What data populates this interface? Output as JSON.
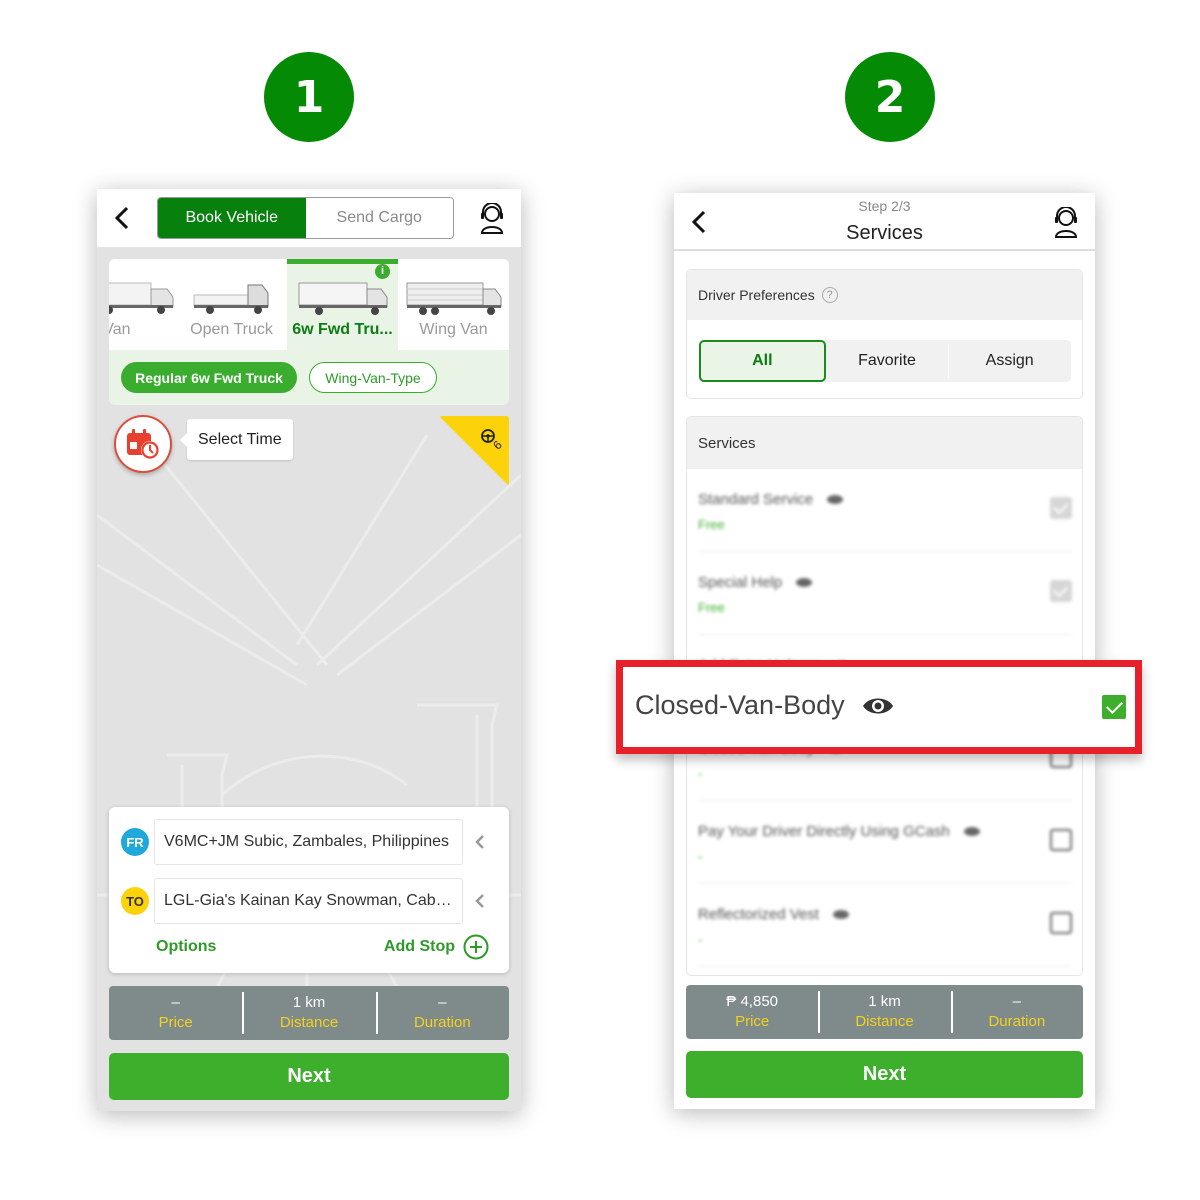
{
  "steps": [
    {
      "number": "1"
    },
    {
      "number": "2"
    }
  ],
  "screen1": {
    "tabs": [
      {
        "label": "Book Vehicle",
        "active": true
      },
      {
        "label": "Send Cargo",
        "active": false
      }
    ],
    "vehicles": [
      {
        "label": "Closed Van",
        "visible_label": "sed Van",
        "selected": false
      },
      {
        "label": "Open Truck",
        "selected": false
      },
      {
        "label": "6w Fwd Tru...",
        "selected": true
      },
      {
        "label": "Wing Van",
        "selected": false
      }
    ],
    "info_badge": "i",
    "subtypes": [
      {
        "label": "Regular 6w Fwd Truck",
        "selected": true
      },
      {
        "label": "Wing-Van-Type",
        "selected": false
      }
    ],
    "select_time_label": "Select Time",
    "corner_badge_count": "9",
    "route": {
      "from_badge": "FR",
      "from_address": "V6MC+JM Subic, Zambales, Philippines",
      "to_badge": "TO",
      "to_address": "LGL-Gia's Kainan Kay Snowman, Caban...",
      "options_label": "Options",
      "add_stop_label": "Add Stop"
    },
    "stats": [
      {
        "value": "–",
        "label": "Price"
      },
      {
        "value": "1 km",
        "label": "Distance"
      },
      {
        "value": "–",
        "label": "Duration"
      }
    ],
    "next_label": "Next"
  },
  "screen2": {
    "step_indicator": "Step 2/3",
    "title": "Services",
    "driver_preferences": {
      "heading": "Driver Preferences",
      "help_icon": "?",
      "options": [
        {
          "label": "All",
          "selected": true
        },
        {
          "label": "Favorite",
          "selected": false
        },
        {
          "label": "Assign",
          "selected": false
        }
      ]
    },
    "services": {
      "heading": "Services",
      "items": [
        {
          "name": "Standard Service",
          "price": "Free",
          "checked": true,
          "disabled": true
        },
        {
          "name": "Special Help",
          "price": "Free",
          "checked": true,
          "disabled": true
        },
        {
          "name": "Add Extra Helpers",
          "price": "-",
          "checked": false,
          "disabled": false
        },
        {
          "name": "Closed-Van-Body",
          "price": "-",
          "checked": true,
          "disabled": false
        },
        {
          "name": "Pay Your Driver Directly Using GCash",
          "price": "-",
          "checked": false,
          "disabled": false
        },
        {
          "name": "Reflectorized Vest",
          "price": "-",
          "checked": false,
          "disabled": false
        }
      ]
    },
    "highlight": {
      "name": "Closed-Van-Body",
      "checked": true
    },
    "stats": [
      {
        "value": "₱ 4,850",
        "label": "Price"
      },
      {
        "value": "1 km",
        "label": "Distance"
      },
      {
        "value": "–",
        "label": "Duration"
      }
    ],
    "next_label": "Next"
  },
  "colors": {
    "brand_green": "#07800d",
    "accent_green": "#3daf2c",
    "highlight_red": "#e8202a",
    "stat_label_yellow": "#f2d21e",
    "stats_bar_gray": "#7f8a8a"
  }
}
